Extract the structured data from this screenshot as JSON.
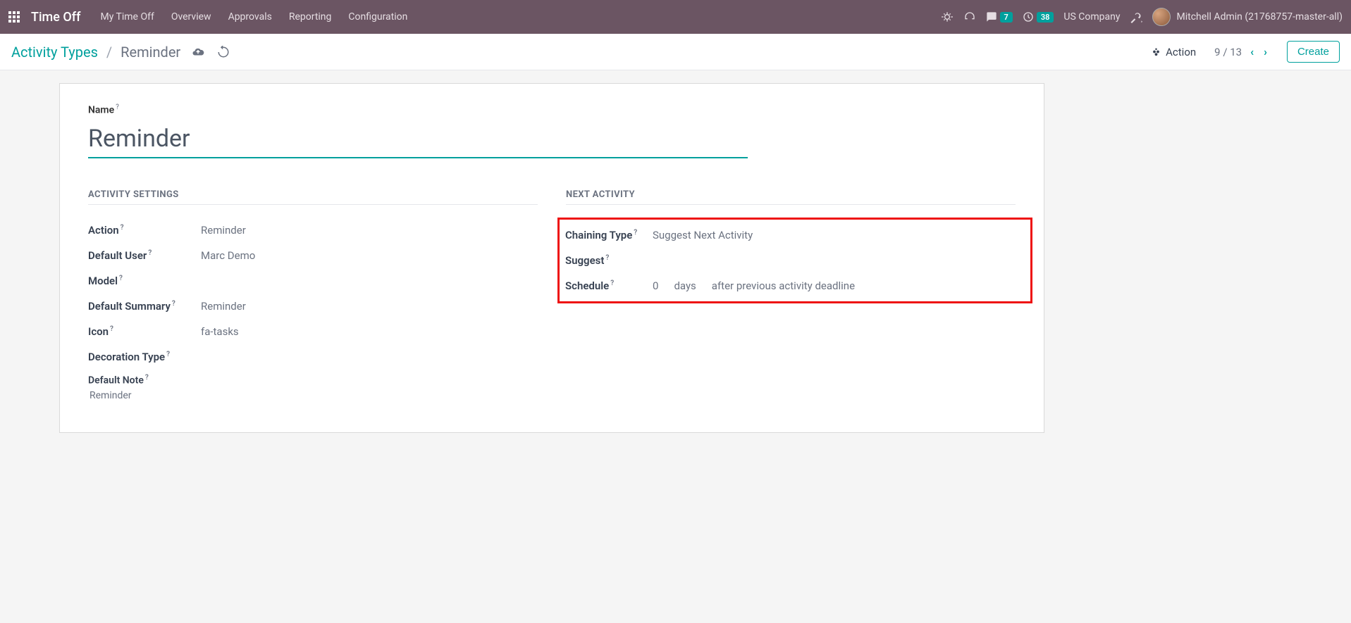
{
  "nav": {
    "app_name": "Time Off",
    "menu": [
      "My Time Off",
      "Overview",
      "Approvals",
      "Reporting",
      "Configuration"
    ],
    "chat_badge": "7",
    "clock_badge": "38",
    "company": "US Company",
    "user": "Mitchell Admin (21768757-master-all)"
  },
  "breadcrumb": {
    "root": "Activity Types",
    "current": "Reminder",
    "action_label": "Action",
    "pager_current": "9",
    "pager_total": "13",
    "create_label": "Create"
  },
  "form": {
    "name_label": "Name",
    "name_value": "Reminder",
    "sections": {
      "left_title": "ACTIVITY SETTINGS",
      "right_title": "NEXT ACTIVITY"
    },
    "left": {
      "action_label": "Action",
      "action_value": "Reminder",
      "default_user_label": "Default User",
      "default_user_value": "Marc Demo",
      "model_label": "Model",
      "model_value": "",
      "default_summary_label": "Default Summary",
      "default_summary_value": "Reminder",
      "icon_label": "Icon",
      "icon_value": "fa-tasks",
      "decoration_label": "Decoration Type",
      "decoration_value": "",
      "default_note_label": "Default Note",
      "default_note_value": "Reminder"
    },
    "right": {
      "chaining_label": "Chaining Type",
      "chaining_value": "Suggest Next Activity",
      "suggest_label": "Suggest",
      "suggest_value": "",
      "schedule_label": "Schedule",
      "schedule_count": "0",
      "schedule_unit": "days",
      "schedule_basis": "after previous activity deadline"
    }
  }
}
